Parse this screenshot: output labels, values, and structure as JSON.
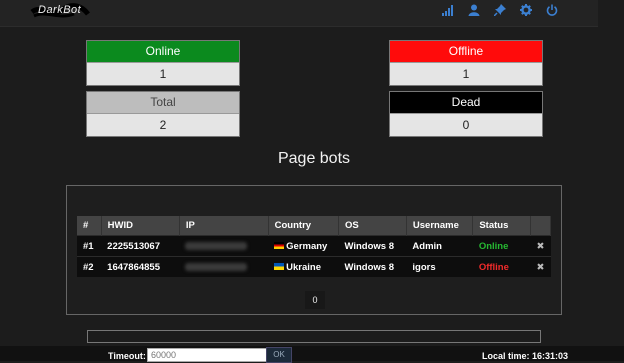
{
  "header": {
    "brand": "DarkBot",
    "icons": [
      "signal-icon",
      "user-icon",
      "pin-icon",
      "gear-icon",
      "power-icon"
    ]
  },
  "stats": {
    "online": {
      "label": "Online",
      "value": "1"
    },
    "offline": {
      "label": "Offline",
      "value": "1"
    },
    "total": {
      "label": "Total",
      "value": "2"
    },
    "dead": {
      "label": "Dead",
      "value": "0"
    }
  },
  "page_title": "Page bots",
  "table": {
    "headers": [
      "#",
      "HWID",
      "IP",
      "Country",
      "OS",
      "Username",
      "Status"
    ],
    "rows": [
      {
        "num": "#1",
        "hwid": "2225513067",
        "ip": "",
        "country": "Germany",
        "os": "Windows 8",
        "username": "Admin",
        "status": "Online"
      },
      {
        "num": "#2",
        "hwid": "1647864855",
        "ip": "",
        "country": "Ukraine",
        "os": "Windows 8",
        "username": "igors",
        "status": "Offline"
      }
    ],
    "delete_glyph": "✖"
  },
  "pager": {
    "current": "0"
  },
  "footer": {
    "timeout_label": "Timeout:",
    "timeout_placeholder": "60000",
    "ok_label": "OK",
    "local_time": "Local time: 16:31:03"
  },
  "colors": {
    "online": "#0b8a1e",
    "offline": "#ff0b0b",
    "total": "#bdbdbd",
    "dead": "#000000",
    "background": "#1c1c1c"
  }
}
